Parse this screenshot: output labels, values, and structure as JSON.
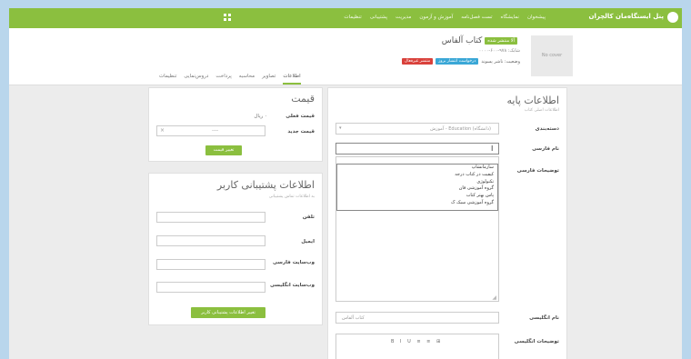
{
  "topbar": {
    "brand": "پنل ایستگاه‌مان کالچران",
    "nav": [
      "پیشخوان",
      "نمایشگاه",
      "تست فصل‌نامه",
      "آموزش و آزمون",
      "مدیریت",
      "پشتیبانی",
      "تنظیمات"
    ]
  },
  "book": {
    "thumb_text": "No cover",
    "title": "کتاب آلفاس",
    "badge": "آلا منتشر شده",
    "isbn": "شابک: ۹۷۸-۶۰۰-۰۰۰۰",
    "status_label": "وضعیت: ناشر پسوند",
    "labels": [
      "درخواست انتشار بروز",
      "منتشر غیرفعال"
    ]
  },
  "tabs": [
    "اطلاعات",
    "تصاویر",
    "محاسبه",
    "پرداخت",
    "دروس‌نمایی",
    "تنظیمات"
  ],
  "price_panel": {
    "title": "قیمت",
    "current_price_label": "قیمت فعلی",
    "current_price_value": "۰ ریال",
    "new_price_label": "قیمت جدید",
    "new_price_placeholder": "----",
    "submit": "تغییر قیمت"
  },
  "support_panel": {
    "title": "اطلاعات پشتیبانی کاربر",
    "subtitle": "به اطلاعات تماس پشتیبانی",
    "fields": [
      "تلفن",
      "ایمیل",
      "وب‌سایت فارسی",
      "وب‌سایت انگلیسی"
    ],
    "submit": "تغییر اطلاعات پشتیبانی کاربر"
  },
  "base_panel": {
    "title": "اطلاعات پایه",
    "subtitle": "اطلاعات اصلی کتاب",
    "category_label": "دسته‌بندی",
    "category_value": "آموزش - Education (دانشگاه)",
    "persian_name_label": "نام فارسی",
    "persian_desc_label": "توضیحات فارسی",
    "english_name_label": "نام انگلیسی",
    "english_name_value": "کتاب آلفاس",
    "english_desc_label": "توضیحات انگلیسی",
    "dropdown_options": [
      "سازمانشاپ",
      "کیفیت در کتاب درجه",
      "تکنولوژی",
      "گروه آموزشی فان",
      "پاس بهتر کتاب",
      "گروه آموزشی سبک ک"
    ],
    "toolbar": [
      "B",
      "I",
      "U",
      "≡",
      "≡",
      "⊞"
    ]
  }
}
